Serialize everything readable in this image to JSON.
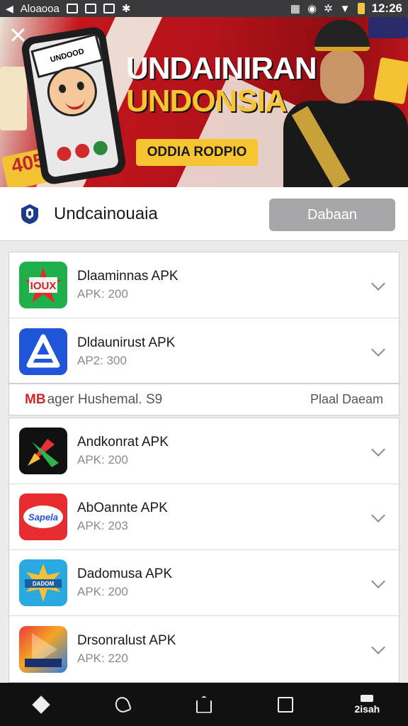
{
  "status_bar": {
    "carrier": "Aloaooa",
    "time": "12:26"
  },
  "banner": {
    "phone_sign": "UNDOOD",
    "title_line1": "UNDAINIRAN",
    "title_line2": "UNDONSIA",
    "cta_label": "ODDIA RODPIO",
    "badge": "405"
  },
  "header": {
    "title": "Undcainouaia",
    "button_label": "Dabaan"
  },
  "ad": {
    "badge": "MB",
    "text": "ager Hushemal. S9",
    "right_text": "Plaal Daeam"
  },
  "apps_group1": [
    {
      "name": "Dlaaminnas APK",
      "sub": "APK: 200",
      "icon": "star-shield-icon",
      "colors": [
        "#1fb04b",
        "#0e8a36"
      ]
    },
    {
      "name": "Dldaunirust APK",
      "sub": "AP2: 300",
      "icon": "triangle-a-icon",
      "colors": [
        "#1f56d9",
        "#1440a8"
      ]
    }
  ],
  "apps_group2": [
    {
      "name": "Andkonrat APK",
      "sub": "APK: 200",
      "icon": "arrow-x-icon",
      "colors": [
        "#111111",
        "#222222"
      ]
    },
    {
      "name": "AbOannte APK",
      "sub": "APK: 203",
      "icon": "sapela-badge-icon",
      "colors": [
        "#e62c2f",
        "#ffffff"
      ]
    },
    {
      "name": "Dadomusa APK",
      "sub": "APK: 200",
      "icon": "splash-logo-icon",
      "colors": [
        "#2aa9e0",
        "#f5c038"
      ]
    },
    {
      "name": "Drsonralust APK",
      "sub": "APK: 220",
      "icon": "play-prism-icon",
      "colors": [
        "#ec3b3b",
        "#2f7de0"
      ]
    }
  ],
  "nav": {
    "right_label": "2isah"
  }
}
